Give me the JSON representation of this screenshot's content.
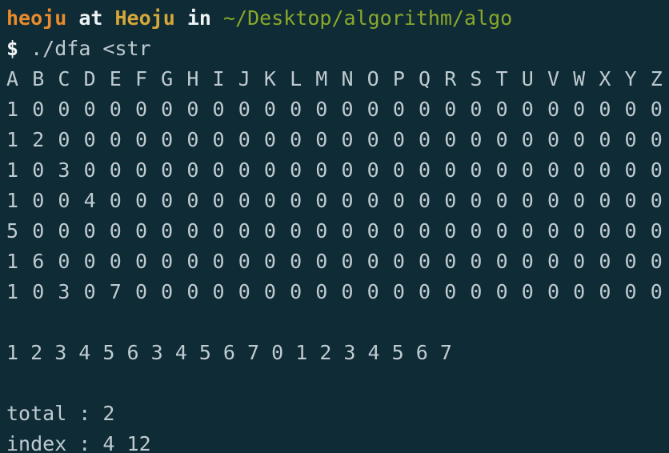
{
  "prompt": {
    "user": "heoju",
    "at": "at",
    "host": "Heoju",
    "in": "in",
    "path": "~/Desktop/algorithm/algo",
    "dollar": "$",
    "command": "./dfa <str"
  },
  "table": {
    "header": [
      "A",
      "B",
      "C",
      "D",
      "E",
      "F",
      "G",
      "H",
      "I",
      "J",
      "K",
      "L",
      "M",
      "N",
      "O",
      "P",
      "Q",
      "R",
      "S",
      "T",
      "U",
      "V",
      "W",
      "X",
      "Y",
      "Z"
    ],
    "rows": [
      [
        "1",
        "0",
        "0",
        "0",
        "0",
        "0",
        "0",
        "0",
        "0",
        "0",
        "0",
        "0",
        "0",
        "0",
        "0",
        "0",
        "0",
        "0",
        "0",
        "0",
        "0",
        "0",
        "0",
        "0",
        "0",
        "0"
      ],
      [
        "1",
        "2",
        "0",
        "0",
        "0",
        "0",
        "0",
        "0",
        "0",
        "0",
        "0",
        "0",
        "0",
        "0",
        "0",
        "0",
        "0",
        "0",
        "0",
        "0",
        "0",
        "0",
        "0",
        "0",
        "0",
        "0"
      ],
      [
        "1",
        "0",
        "3",
        "0",
        "0",
        "0",
        "0",
        "0",
        "0",
        "0",
        "0",
        "0",
        "0",
        "0",
        "0",
        "0",
        "0",
        "0",
        "0",
        "0",
        "0",
        "0",
        "0",
        "0",
        "0",
        "0"
      ],
      [
        "1",
        "0",
        "0",
        "4",
        "0",
        "0",
        "0",
        "0",
        "0",
        "0",
        "0",
        "0",
        "0",
        "0",
        "0",
        "0",
        "0",
        "0",
        "0",
        "0",
        "0",
        "0",
        "0",
        "0",
        "0",
        "0"
      ],
      [
        "5",
        "0",
        "0",
        "0",
        "0",
        "0",
        "0",
        "0",
        "0",
        "0",
        "0",
        "0",
        "0",
        "0",
        "0",
        "0",
        "0",
        "0",
        "0",
        "0",
        "0",
        "0",
        "0",
        "0",
        "0",
        "0"
      ],
      [
        "1",
        "6",
        "0",
        "0",
        "0",
        "0",
        "0",
        "0",
        "0",
        "0",
        "0",
        "0",
        "0",
        "0",
        "0",
        "0",
        "0",
        "0",
        "0",
        "0",
        "0",
        "0",
        "0",
        "0",
        "0",
        "0"
      ],
      [
        "1",
        "0",
        "3",
        "0",
        "7",
        "0",
        "0",
        "0",
        "0",
        "0",
        "0",
        "0",
        "0",
        "0",
        "0",
        "0",
        "0",
        "0",
        "0",
        "0",
        "0",
        "0",
        "0",
        "0",
        "0",
        "0"
      ]
    ]
  },
  "states_line": "1 2 3 4 5 6 3 4 5 6 7 0 1 2 3 4 5 6 7",
  "total_line": "total : 2",
  "index_line": "index : 4 12",
  "colors": {
    "background": "#0f2b36",
    "text": "#bfcbd0",
    "user": "#e98b2c",
    "host": "#d6a739",
    "path": "#8aa82a"
  }
}
